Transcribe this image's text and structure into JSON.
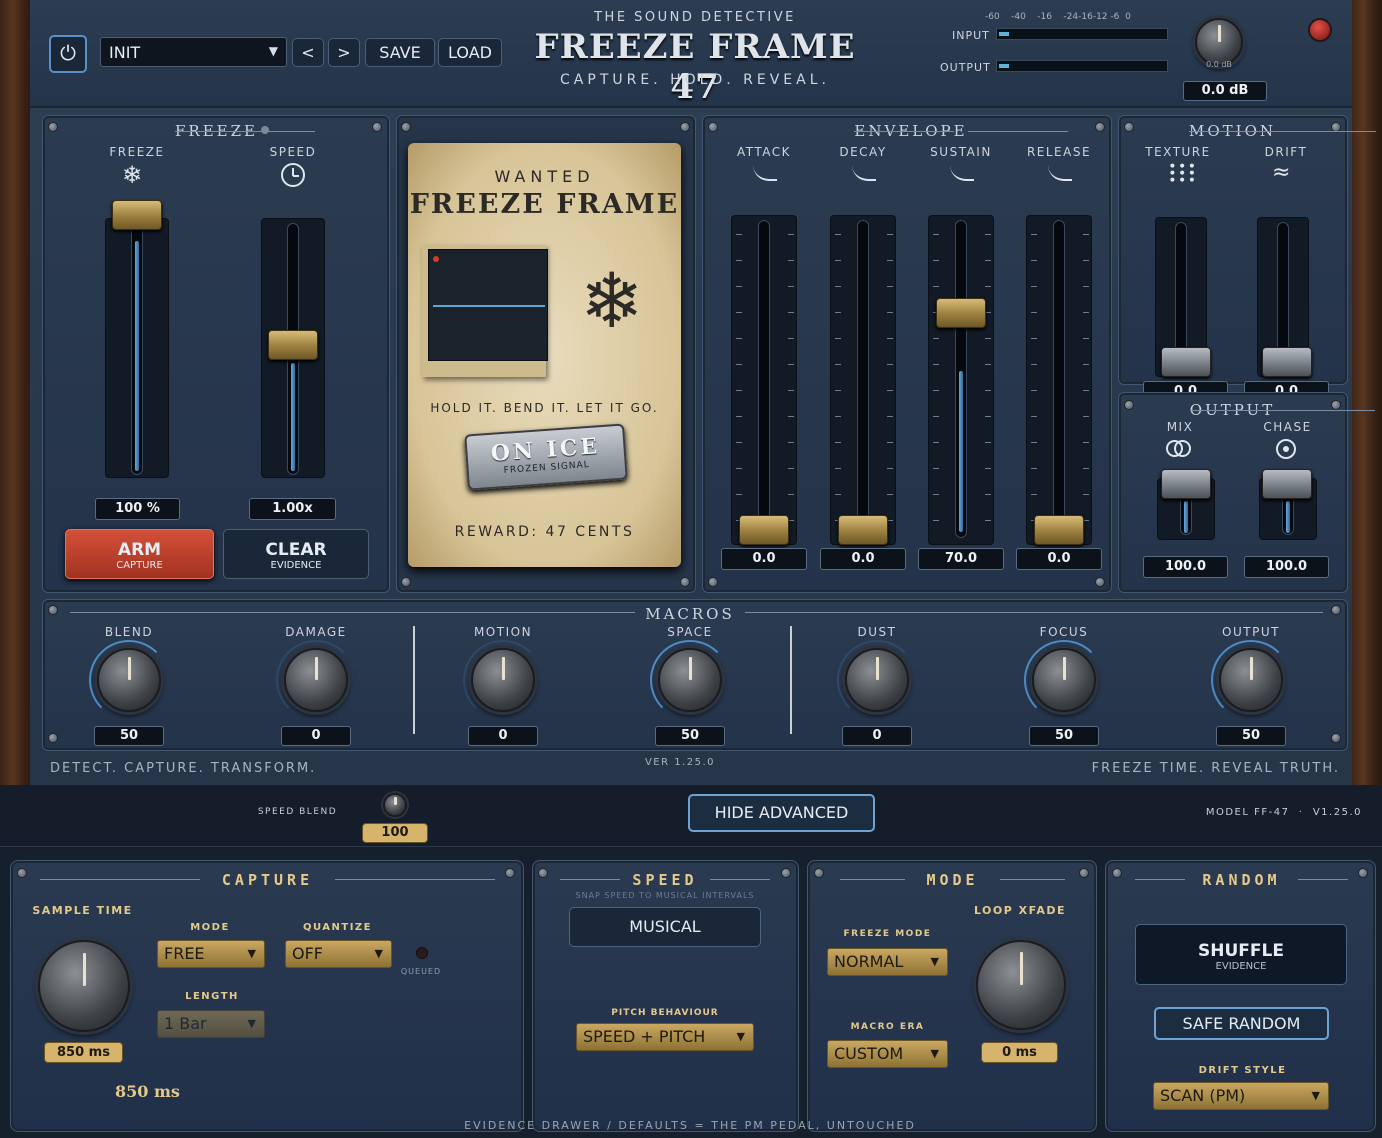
{
  "header": {
    "preset_name": "INIT",
    "prev_label": "<",
    "next_label": ">",
    "save_label": "SAVE",
    "load_label": "LOAD",
    "brand_sub": "THE SOUND DETECTIVE",
    "title": "FREEZE FRAME 47",
    "tagline": "CAPTURE. HOLD. REVEAL.",
    "meter_scale": "-60    -40    -16    -24-16-12 -6  0",
    "input_label": "INPUT",
    "output_label": "OUTPUT",
    "gain_knob_label": "0.0 dB",
    "gain_value": "0.0 dB"
  },
  "freeze": {
    "title": "FREEZE",
    "freeze_label": "FREEZE",
    "speed_label": "SPEED",
    "freeze_value": "100 %",
    "freeze_level": 1.0,
    "speed_value": "1.00x",
    "speed_level": 0.47,
    "arm_label": "ARM",
    "arm_sub": "CAPTURE",
    "clear_label": "CLEAR",
    "clear_sub": "EVIDENCE"
  },
  "poster": {
    "wanted": "WANTED",
    "name": "FREEZE FRAME",
    "motto": "HOLD IT. BEND IT. LET IT GO.",
    "badge_title": "ON ICE",
    "badge_sub": "FROZEN SIGNAL",
    "reward": "REWARD: 47 CENTS"
  },
  "envelope": {
    "title": "ENVELOPE",
    "faders": [
      {
        "label": "ATTACK",
        "value": "0.0",
        "level": 0.0
      },
      {
        "label": "DECAY",
        "value": "0.0",
        "level": 0.0
      },
      {
        "label": "SUSTAIN",
        "value": "70.0",
        "level": 0.7
      },
      {
        "label": "RELEASE",
        "value": "0.0",
        "level": 0.0
      }
    ]
  },
  "motion": {
    "title": "MOTION",
    "texture_label": "TEXTURE",
    "drift_label": "DRIFT",
    "texture_value": "0.0",
    "drift_value": "0.0"
  },
  "output_panel": {
    "title": "OUTPUT",
    "mix_label": "MIX",
    "chase_label": "CHASE",
    "mix_value": "100.0",
    "chase_value": "100.0"
  },
  "macros": {
    "title": "MACROS",
    "knobs": [
      {
        "label": "BLEND",
        "value": "50"
      },
      {
        "label": "DAMAGE",
        "value": "0"
      },
      {
        "label": "MOTION",
        "value": "0"
      },
      {
        "label": "SPACE",
        "value": "50"
      },
      {
        "label": "DUST",
        "value": "0"
      },
      {
        "label": "FOCUS",
        "value": "50"
      },
      {
        "label": "OUTPUT",
        "value": "50"
      }
    ],
    "footer_left": "DETECT. CAPTURE. TRANSFORM.",
    "version": "VER 1.25.0",
    "footer_right": "FREEZE TIME. REVEAL TRUTH."
  },
  "advanced_bar": {
    "speed_blend_label": "SPEED BLEND",
    "speed_blend_value": "100",
    "hide_label": "HIDE ADVANCED",
    "model": "MODEL FF-47  ·  V1.25.0"
  },
  "capture": {
    "title": "CAPTURE",
    "sample_time_label": "SAMPLE TIME",
    "sample_time_value": "850 ms",
    "sample_time_readout": "850 ms",
    "mode_label": "MODE",
    "mode_value": "FREE",
    "quantize_label": "QUANTIZE",
    "quantize_value": "OFF",
    "queued_label": "QUEUED",
    "length_label": "LENGTH",
    "length_value": "1 Bar"
  },
  "speed": {
    "title": "SPEED",
    "subtitle": "SNAP SPEED TO MUSICAL INTERVALS",
    "musical_label": "MUSICAL",
    "pitch_label": "PITCH BEHAVIOUR",
    "pitch_value": "SPEED + PITCH"
  },
  "mode": {
    "title": "MODE",
    "freeze_mode_label": "FREEZE MODE",
    "freeze_mode_value": "NORMAL",
    "loop_xfade_label": "LOOP XFADE",
    "loop_xfade_value": "0 ms",
    "macro_era_label": "MACRO ERA",
    "macro_era_value": "CUSTOM"
  },
  "random": {
    "title": "RANDOM",
    "shuffle_label": "SHUFFLE",
    "shuffle_sub": "EVIDENCE",
    "safe_random_label": "SAFE RANDOM",
    "drift_style_label": "DRIFT STYLE",
    "drift_style_value": "SCAN (PM)"
  },
  "footer_note": "EVIDENCE DRAWER / DEFAULTS = THE PM PEDAL, UNTOUCHED",
  "colors": {
    "accent_blue": "#4d8cc4",
    "gold": "#e4c98c",
    "arm_red": "#c2402c"
  }
}
